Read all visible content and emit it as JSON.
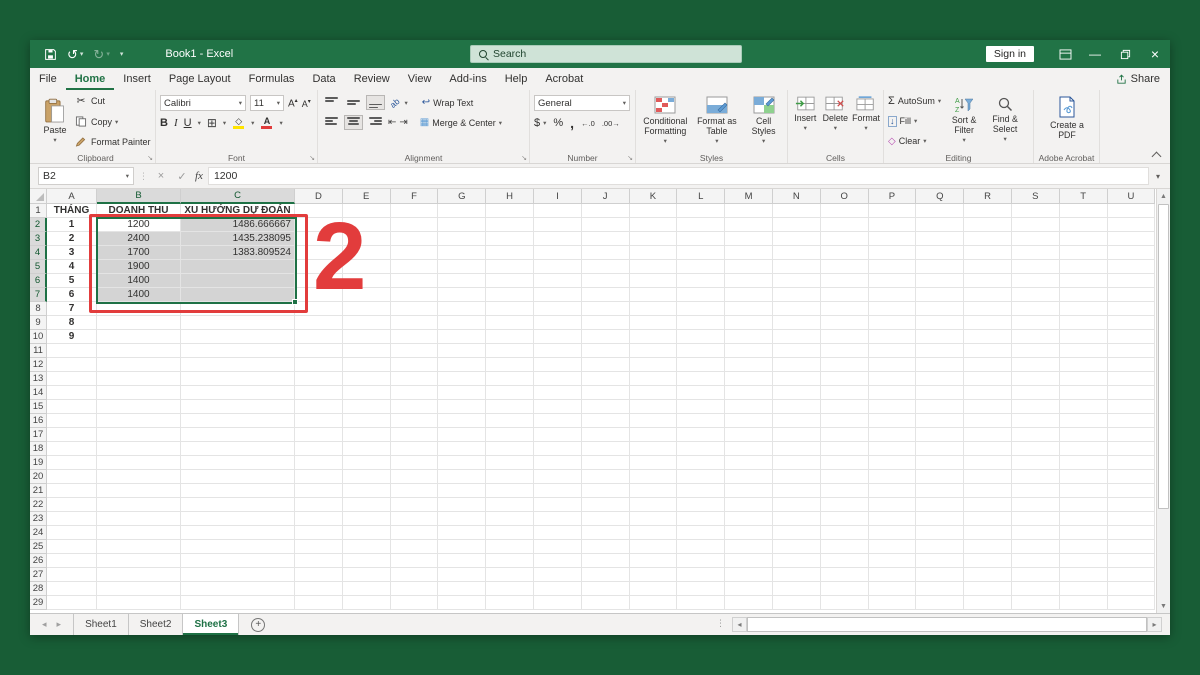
{
  "app": {
    "title": "Book1 - Excel"
  },
  "titlebar": {
    "search_placeholder": "Search",
    "sign_in": "Sign in"
  },
  "menu": {
    "tabs": [
      "File",
      "Home",
      "Insert",
      "Page Layout",
      "Formulas",
      "Data",
      "Review",
      "View",
      "Add-ins",
      "Help",
      "Acrobat"
    ],
    "active_tab": "Home",
    "share_label": "Share"
  },
  "ribbon": {
    "clipboard": {
      "label": "Clipboard",
      "paste": "Paste",
      "cut": "Cut",
      "copy": "Copy",
      "format_painter": "Format Painter"
    },
    "font": {
      "label": "Font",
      "family": "Calibri",
      "size": "11",
      "bold": "B",
      "italic": "I",
      "underline": "U"
    },
    "alignment": {
      "label": "Alignment",
      "wrap_text": "Wrap Text",
      "merge_center": "Merge & Center"
    },
    "number": {
      "label": "Number",
      "format": "General"
    },
    "styles": {
      "label": "Styles",
      "conditional_formatting": "Conditional Formatting",
      "format_as_table": "Format as Table",
      "cell_styles": "Cell Styles"
    },
    "cells": {
      "label": "Cells",
      "insert": "Insert",
      "delete": "Delete",
      "format": "Format"
    },
    "editing": {
      "label": "Editing",
      "autosum": "AutoSum",
      "fill": "Fill",
      "clear": "Clear",
      "sort_filter": "Sort & Filter",
      "find_select": "Find & Select"
    },
    "acrobat": {
      "label": "Adobe Acrobat",
      "create_pdf": "Create a PDF"
    }
  },
  "formula_bar": {
    "name_box": "B2",
    "fx": "fx",
    "value": "1200"
  },
  "icons": {
    "cut": "✂",
    "border": "⊞",
    "autosum": "Σ",
    "clear": "◇",
    "fill": "↓",
    "wrap": "↩",
    "merge": "▦",
    "undo": "↺",
    "redo": "↻",
    "dollar": "$",
    "percent": "%",
    "comma": ",",
    "increase_decimal": "←.0",
    "decrease_decimal": ".00→",
    "cancel": "×",
    "enter": "✓"
  },
  "sheet": {
    "columns": [
      "A",
      "B",
      "C",
      "D",
      "E",
      "F",
      "G",
      "H",
      "I",
      "J",
      "K",
      "L",
      "M",
      "N",
      "O",
      "P",
      "Q",
      "R",
      "S",
      "T",
      "U"
    ],
    "visible_rows": 29,
    "cells": [
      [
        "THÁNG",
        "DOANH THU",
        "XU HƯỚNG DỰ ĐOÁN"
      ],
      [
        "1",
        "1200",
        "1486.666667"
      ],
      [
        "2",
        "2400",
        "1435.238095"
      ],
      [
        "3",
        "1700",
        "1383.809524"
      ],
      [
        "4",
        "1900",
        ""
      ],
      [
        "5",
        "1400",
        ""
      ],
      [
        "6",
        "1400",
        ""
      ],
      [
        "7",
        "",
        ""
      ],
      [
        "8",
        "",
        ""
      ],
      [
        "9",
        "",
        ""
      ]
    ],
    "selection": {
      "range": "B2:C7",
      "active_cell": "B2"
    }
  },
  "sheet_tabs": {
    "tabs": [
      "Sheet1",
      "Sheet2",
      "Sheet3"
    ],
    "active": "Sheet3"
  },
  "annotation": {
    "step_label": "2",
    "color": "#E23C3C"
  },
  "colors": {
    "excel_green": "#217346",
    "frame_green": "#185D36",
    "selection_gray": "#D4D4D4",
    "annotation_red": "#E23C3C"
  }
}
